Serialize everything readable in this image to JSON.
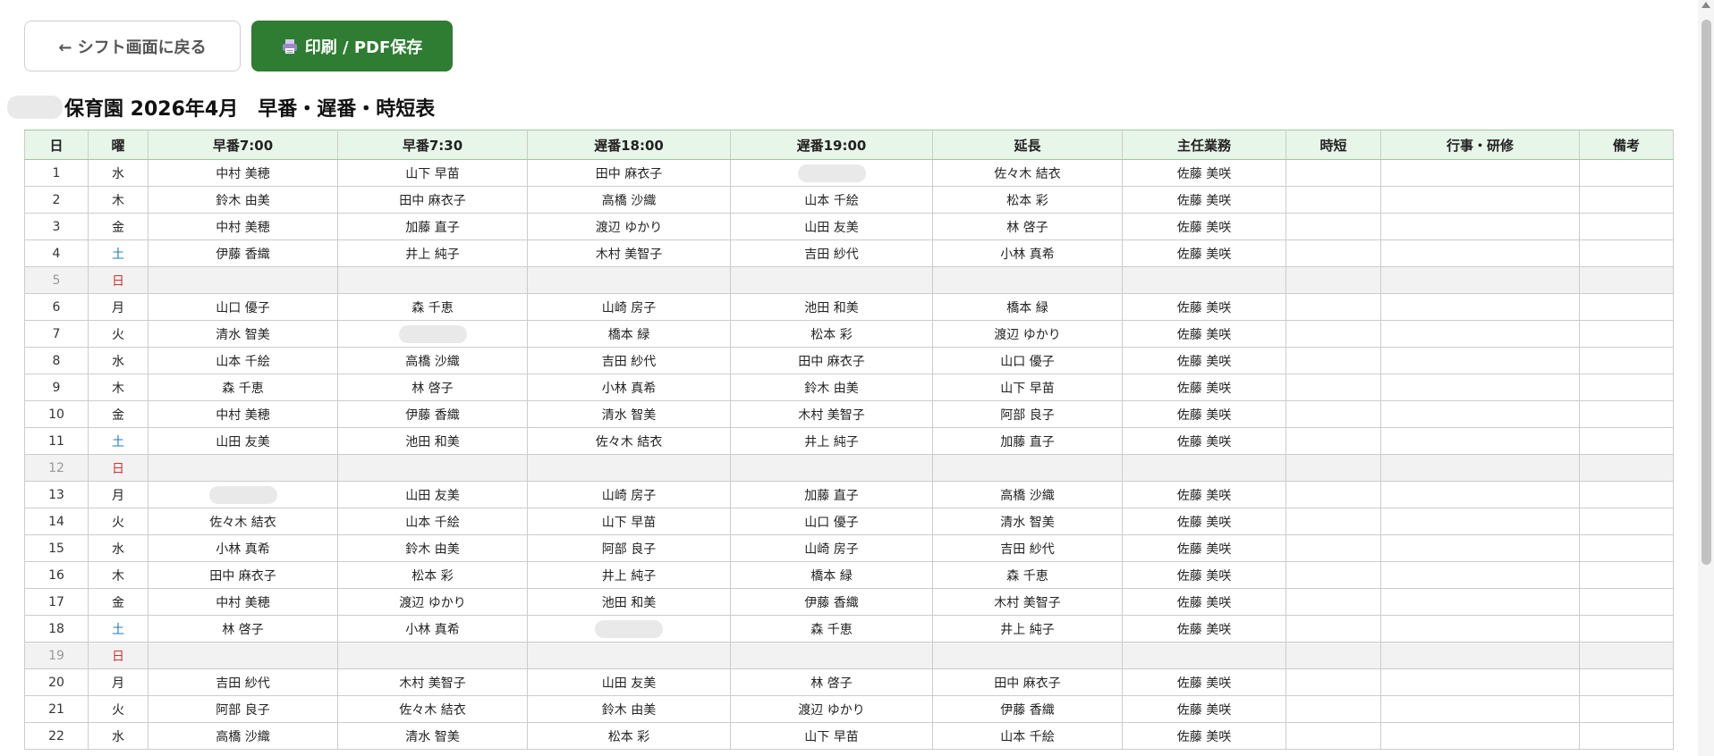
{
  "toolbar": {
    "back_label": "← シフト画面に戻る",
    "print_label": "印刷 / PDF保存"
  },
  "page": {
    "title": "保育園 2026年4月　早番・遅番・時短表"
  },
  "table": {
    "headers": [
      "日",
      "曜",
      "早番7:00",
      "早番7:30",
      "遅番18:00",
      "遅番19:00",
      "延長",
      "主任業務",
      "時短",
      "行事・研修",
      "備考"
    ],
    "rows": [
      {
        "day": "1",
        "dow": "水",
        "e700": "中村 美穂",
        "e730": "山下 早苗",
        "l1800": "田中 麻衣子",
        "l1900": "",
        "ext": "佐々木 結衣",
        "chief": "佐藤 美咲"
      },
      {
        "day": "2",
        "dow": "木",
        "e700": "鈴木 由美",
        "e730": "田中 麻衣子",
        "l1800": "高橋 沙織",
        "l1900": "山本 千絵",
        "ext": "松本 彩",
        "chief": "佐藤 美咲"
      },
      {
        "day": "3",
        "dow": "金",
        "e700": "中村 美穂",
        "e730": "加藤 直子",
        "l1800": "渡辺 ゆかり",
        "l1900": "山田 友美",
        "ext": "林 啓子",
        "chief": "佐藤 美咲"
      },
      {
        "day": "4",
        "dow": "土",
        "e700": "伊藤 香織",
        "e730": "井上 純子",
        "l1800": "木村 美智子",
        "l1900": "吉田 紗代",
        "ext": "小林 真希",
        "chief": "佐藤 美咲"
      },
      {
        "day": "5",
        "dow": "日",
        "e700": "",
        "e730": "",
        "l1800": "",
        "l1900": "",
        "ext": "",
        "chief": ""
      },
      {
        "day": "6",
        "dow": "月",
        "e700": "山口 優子",
        "e730": "森 千恵",
        "l1800": "山崎 房子",
        "l1900": "池田 和美",
        "ext": "橋本 緑",
        "chief": "佐藤 美咲"
      },
      {
        "day": "7",
        "dow": "火",
        "e700": "清水 智美",
        "e730": "",
        "l1800": "橋本 緑",
        "l1900": "松本 彩",
        "ext": "渡辺 ゆかり",
        "chief": "佐藤 美咲"
      },
      {
        "day": "8",
        "dow": "水",
        "e700": "山本 千絵",
        "e730": "高橋 沙織",
        "l1800": "吉田 紗代",
        "l1900": "田中 麻衣子",
        "ext": "山口 優子",
        "chief": "佐藤 美咲"
      },
      {
        "day": "9",
        "dow": "木",
        "e700": "森 千恵",
        "e730": "林 啓子",
        "l1800": "小林 真希",
        "l1900": "鈴木 由美",
        "ext": "山下 早苗",
        "chief": "佐藤 美咲"
      },
      {
        "day": "10",
        "dow": "金",
        "e700": "中村 美穂",
        "e730": "伊藤 香織",
        "l1800": "清水 智美",
        "l1900": "木村 美智子",
        "ext": "阿部 良子",
        "chief": "佐藤 美咲"
      },
      {
        "day": "11",
        "dow": "土",
        "e700": "山田 友美",
        "e730": "池田 和美",
        "l1800": "佐々木 結衣",
        "l1900": "井上 純子",
        "ext": "加藤 直子",
        "chief": "佐藤 美咲"
      },
      {
        "day": "12",
        "dow": "日",
        "e700": "",
        "e730": "",
        "l1800": "",
        "l1900": "",
        "ext": "",
        "chief": ""
      },
      {
        "day": "13",
        "dow": "月",
        "e700": "",
        "e730": "山田 友美",
        "l1800": "山崎 房子",
        "l1900": "加藤 直子",
        "ext": "高橋 沙織",
        "chief": "佐藤 美咲"
      },
      {
        "day": "14",
        "dow": "火",
        "e700": "佐々木 結衣",
        "e730": "山本 千絵",
        "l1800": "山下 早苗",
        "l1900": "山口 優子",
        "ext": "清水 智美",
        "chief": "佐藤 美咲"
      },
      {
        "day": "15",
        "dow": "水",
        "e700": "小林 真希",
        "e730": "鈴木 由美",
        "l1800": "阿部 良子",
        "l1900": "山崎 房子",
        "ext": "吉田 紗代",
        "chief": "佐藤 美咲"
      },
      {
        "day": "16",
        "dow": "木",
        "e700": "田中 麻衣子",
        "e730": "松本 彩",
        "l1800": "井上 純子",
        "l1900": "橋本 緑",
        "ext": "森 千恵",
        "chief": "佐藤 美咲"
      },
      {
        "day": "17",
        "dow": "金",
        "e700": "中村 美穂",
        "e730": "渡辺 ゆかり",
        "l1800": "池田 和美",
        "l1900": "伊藤 香織",
        "ext": "木村 美智子",
        "chief": "佐藤 美咲"
      },
      {
        "day": "18",
        "dow": "土",
        "e700": "林 啓子",
        "e730": "小林 真希",
        "l1800": "",
        "l1900": "森 千恵",
        "ext": "井上 純子",
        "chief": "佐藤 美咲"
      },
      {
        "day": "19",
        "dow": "日",
        "e700": "",
        "e730": "",
        "l1800": "",
        "l1900": "",
        "ext": "",
        "chief": ""
      },
      {
        "day": "20",
        "dow": "月",
        "e700": "吉田 紗代",
        "e730": "木村 美智子",
        "l1800": "山田 友美",
        "l1900": "林 啓子",
        "ext": "田中 麻衣子",
        "chief": "佐藤 美咲"
      },
      {
        "day": "21",
        "dow": "火",
        "e700": "阿部 良子",
        "e730": "佐々木 結衣",
        "l1800": "鈴木 由美",
        "l1900": "渡辺 ゆかり",
        "ext": "伊藤 香織",
        "chief": "佐藤 美咲"
      },
      {
        "day": "22",
        "dow": "水",
        "e700": "高橋 沙織",
        "e730": "清水 智美",
        "l1800": "松本 彩",
        "l1900": "山下 早苗",
        "ext": "山本 千絵",
        "chief": "佐藤 美咲"
      }
    ]
  }
}
